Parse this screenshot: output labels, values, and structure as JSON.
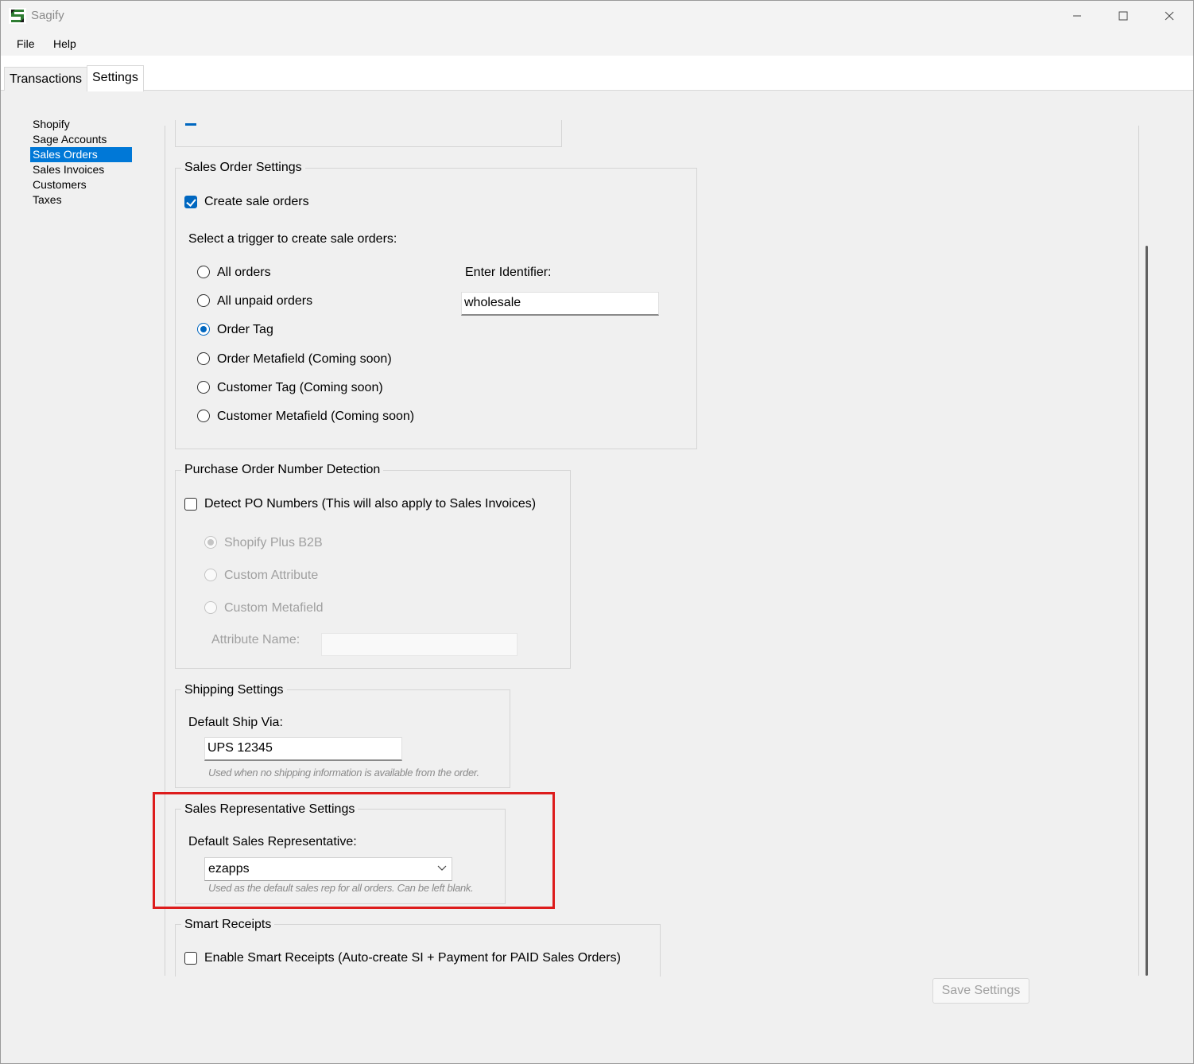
{
  "window": {
    "title": "Sagify"
  },
  "menu": {
    "file": "File",
    "help": "Help"
  },
  "tabs": [
    {
      "label": "Transactions"
    },
    {
      "label": "Settings"
    }
  ],
  "sidebar": {
    "items": [
      {
        "label": "Shopify"
      },
      {
        "label": "Sage Accounts"
      },
      {
        "label": "Sales Orders",
        "selected": true
      },
      {
        "label": "Sales Invoices"
      },
      {
        "label": "Customers"
      },
      {
        "label": "Taxes"
      }
    ]
  },
  "sales_order_settings": {
    "title": "Sales Order Settings",
    "create_sale_orders": {
      "label": "Create sale orders",
      "checked": true
    },
    "trigger_prompt": "Select a trigger to create sale orders:",
    "triggers": [
      {
        "label": "All orders",
        "checked": false
      },
      {
        "label": "All unpaid orders",
        "checked": false
      },
      {
        "label": "Order Tag",
        "checked": true
      },
      {
        "label": "Order Metafield (Coming soon)",
        "checked": false
      },
      {
        "label": "Customer Tag (Coming soon)",
        "checked": false
      },
      {
        "label": "Customer Metafield (Coming soon)",
        "checked": false
      }
    ],
    "identifier_label": "Enter Identifier:",
    "identifier_value": "wholesale"
  },
  "po_detection": {
    "title": "Purchase Order Number Detection",
    "detect_po": {
      "label": "Detect PO Numbers (This will also apply to Sales Invoices)",
      "checked": false
    },
    "sources": [
      {
        "label": "Shopify Plus B2B",
        "checked": true
      },
      {
        "label": "Custom Attribute",
        "checked": false
      },
      {
        "label": "Custom Metafield",
        "checked": false
      }
    ],
    "attribute_name_label": "Attribute Name:",
    "attribute_name_value": ""
  },
  "shipping_settings": {
    "title": "Shipping Settings",
    "ship_via_label": "Default Ship Via:",
    "ship_via_value": "UPS 12345",
    "hint": "Used when no shipping information is available from the order."
  },
  "sales_rep_settings": {
    "title": "Sales Representative Settings",
    "rep_label": "Default Sales Representative:",
    "rep_value": "ezapps",
    "hint": "Used as the default sales rep for all orders. Can be left blank."
  },
  "smart_receipts": {
    "title": "Smart Receipts",
    "enable": {
      "label": "Enable Smart Receipts (Auto-create SI + Payment for PAID Sales Orders)",
      "checked": false
    }
  },
  "save_button": "Save Settings",
  "colors": {
    "accent": "#0067c0",
    "selection": "#0078d7",
    "highlight_box": "#dd1c1c"
  }
}
